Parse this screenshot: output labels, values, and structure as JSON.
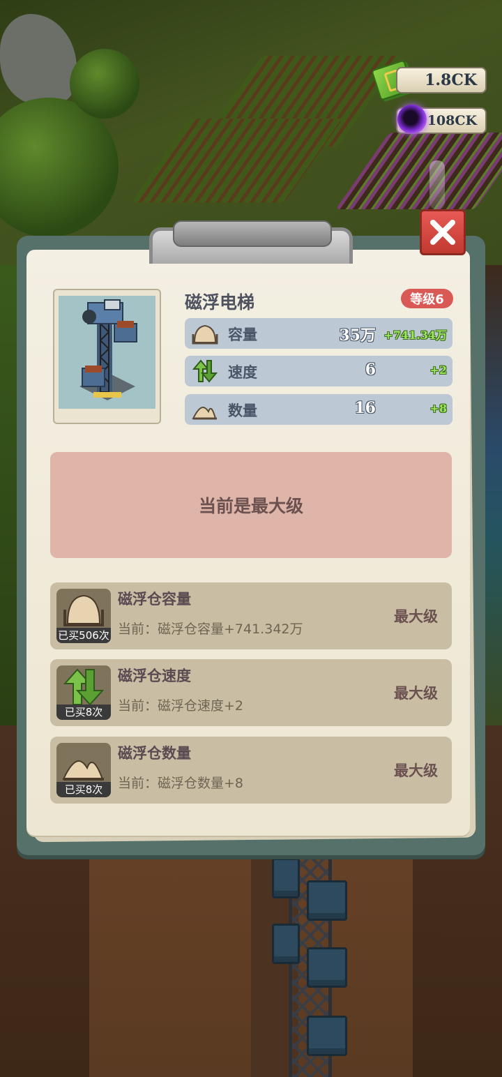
{
  "currency": {
    "cash": "1.8CK",
    "gems": "108CK"
  },
  "item": {
    "title": "磁浮电梯",
    "level": "等级6"
  },
  "stats": [
    {
      "icon": "capacity-icon",
      "label": "容量",
      "value": "35万",
      "bonus": "+741.34万"
    },
    {
      "icon": "speed-icon",
      "label": "速度",
      "value": "6",
      "bonus": "+2"
    },
    {
      "icon": "quantity-icon",
      "label": "数量",
      "value": "16",
      "bonus": "+8"
    }
  ],
  "max_notice": "当前是最大级",
  "upgrades": [
    {
      "icon": "capacity-icon",
      "count": "已买506次",
      "name": "磁浮仓容量",
      "desc": "当前：磁浮仓容量+741.342万",
      "button": "最大级"
    },
    {
      "icon": "speed-icon",
      "count": "已买8次",
      "name": "磁浮仓速度",
      "desc": "当前：磁浮仓速度+2",
      "button": "最大级"
    },
    {
      "icon": "quantity-icon",
      "count": "已买8次",
      "name": "磁浮仓数量",
      "desc": "当前：磁浮仓数量+8",
      "button": "最大级"
    }
  ],
  "colors": {
    "accent_red": "#d95a55",
    "bonus_green": "#9be65a",
    "max_banner": "#deb5a8"
  }
}
